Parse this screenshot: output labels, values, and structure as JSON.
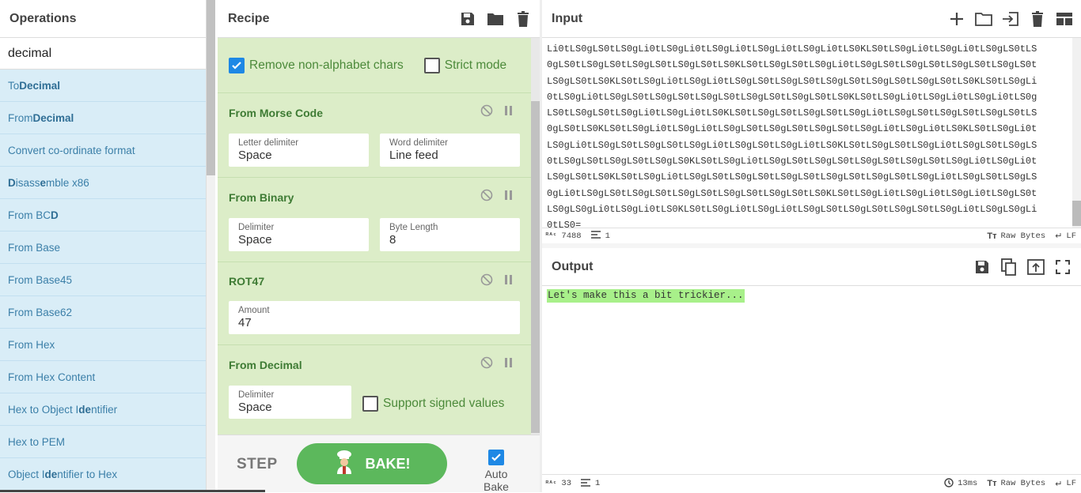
{
  "operations": {
    "title": "Operations",
    "search_value": "decimal",
    "items": [
      {
        "pre": "To ",
        "bold": "Decimal",
        "post": ""
      },
      {
        "pre": "From ",
        "bold": "Decimal",
        "post": ""
      },
      {
        "pre": "Convert co-ordinate format",
        "bold": "",
        "post": ""
      },
      {
        "pre": "",
        "bold": "D",
        "post": "isass",
        "bold2": "e",
        "post2": "mble x86"
      },
      {
        "pre": "From BC",
        "bold": "D",
        "post": ""
      },
      {
        "pre": "From Base",
        "bold": "",
        "post": ""
      },
      {
        "pre": "From Base45",
        "bold": "",
        "post": ""
      },
      {
        "pre": "From Base62",
        "bold": "",
        "post": ""
      },
      {
        "pre": "From Hex",
        "bold": "",
        "post": ""
      },
      {
        "pre": "From Hex Content",
        "bold": "",
        "post": ""
      },
      {
        "pre": "Hex to Object I",
        "bold": "de",
        "post": "ntifier"
      },
      {
        "pre": "Hex to PEM",
        "bold": "",
        "post": ""
      },
      {
        "pre": "Object I",
        "bold": "de",
        "post": "ntifier to Hex"
      }
    ]
  },
  "recipe": {
    "title": "Recipe",
    "remove_nonalpha": {
      "label": "Remove non-alphabet chars",
      "checked": true
    },
    "strict_mode": {
      "label": "Strict mode",
      "checked": false
    },
    "ops": [
      {
        "name": "From Morse Code",
        "args": [
          {
            "label": "Letter delimiter",
            "value": "Space"
          },
          {
            "label": "Word delimiter",
            "value": "Line feed"
          }
        ]
      },
      {
        "name": "From Binary",
        "args": [
          {
            "label": "Delimiter",
            "value": "Space"
          },
          {
            "label": "Byte Length",
            "value": "8"
          }
        ]
      },
      {
        "name": "ROT47",
        "args": [
          {
            "label": "Amount",
            "value": "47"
          }
        ]
      },
      {
        "name": "From Decimal",
        "args": [
          {
            "label": "Delimiter",
            "value": "Space"
          }
        ],
        "checkbox": "Support signed values"
      }
    ],
    "step_label": "STEP",
    "bake_label": "BAKE!",
    "autobake_label": "Auto Bake"
  },
  "input": {
    "title": "Input",
    "lines": [
      "Li0tLS0gLS0tLS0gLi0tLS0gLi0tLS0gLi0tLS0gLi0tLS0gLi0tLS0KLS0tLS0gLi0tLS0gLi0tLS0gLS0tLS",
      "0gLS0tLS0gLS0tLS0gLS0tLS0gLS0tLS0KLS0tLS0gLS0tLS0gLi0tLS0gLS0tLS0gLS0tLS0gLS0tLS0gLS0t",
      "LS0gLS0tLS0KLS0tLS0gLi0tLS0gLi0tLS0gLS0tLS0gLS0tLS0gLS0tLS0gLS0tLS0gLS0tLS0KLS0tLS0gLi",
      "0tLS0gLi0tLS0gLS0tLS0gLS0tLS0gLS0tLS0gLS0tLS0gLS0tLS0KLS0tLS0gLi0tLS0gLi0tLS0gLi0tLS0g",
      "LS0tLS0gLS0tLS0gLi0tLS0gLi0tLS0KLS0tLS0gLS0tLS0gLS0tLS0gLi0tLS0gLS0tLS0gLS0tLS0gLS0tLS",
      "0gLS0tLS0KLS0tLS0gLi0tLS0gLi0tLS0gLS0tLS0gLS0tLS0gLS0tLS0gLi0tLS0gLi0tLS0KLS0tLS0gLi0t",
      "LS0gLi0tLS0gLS0tLS0gLS0tLS0gLi0tLS0gLS0tLS0gLi0tLS0KLS0tLS0gLS0tLS0gLi0tLS0gLS0tLS0gLS",
      "0tLS0gLS0tLS0gLS0tLS0gLS0KLS0tLS0gLi0tLS0gLS0tLS0gLS0tLS0gLS0tLS0gLS0tLS0gLi0tLS0gLi0t",
      "LS0gLS0tLS0KLS0tLS0gLi0tLS0gLS0tLS0gLS0tLS0gLS0tLS0gLS0tLS0gLS0tLS0gLi0tLS0gLS0tLS0gLS",
      "0gLi0tLS0gLS0tLS0gLS0tLS0gLS0tLS0gLS0tLS0gLS0tLS0KLS0tLS0gLi0tLS0gLi0tLS0gLi0tLS0gLS0t",
      "LS0gLS0gLi0tLS0gLi0tLS0KLS0tLS0gLi0tLS0gLi0tLS0gLS0tLS0gLS0tLS0gLS0tLS0gLi0tLS0gLS0gLi",
      "0tLS0="
    ],
    "chars": "7488",
    "lines_count": "1",
    "raw_bytes": "Raw Bytes",
    "eol": "LF"
  },
  "output": {
    "title": "Output",
    "text": "Let's make this a bit trickier...",
    "chars": "33",
    "lines_count": "1",
    "time": "13ms",
    "raw_bytes": "Raw Bytes",
    "eol": "LF"
  },
  "colors": {
    "accent_green": "#5cb85c",
    "op_blue": "#d9edf7",
    "recipe_green": "#dcedc8",
    "output_highlight": "#a8f08a"
  }
}
